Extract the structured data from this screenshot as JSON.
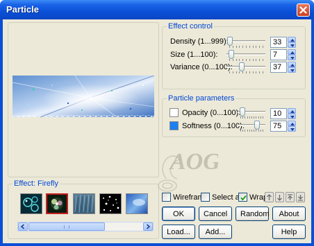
{
  "window": {
    "title": "Particle"
  },
  "preview": {
    "effect_label": "Effect: Firefly"
  },
  "effect_control": {
    "group_title": "Effect control",
    "rows": [
      {
        "label": "Density (1...999):",
        "value": "33",
        "level": 0.03
      },
      {
        "label": "Size (1...100):",
        "value": "7",
        "level": 0.06
      },
      {
        "label": "Variance (0...100):",
        "value": "37",
        "level": 0.37
      }
    ]
  },
  "particle_parameters": {
    "group_title": "Particle parameters",
    "rows": [
      {
        "label": "Opacity (0...100):",
        "value": "10",
        "level": 0.1,
        "swatch_color": "#ffffff"
      },
      {
        "label": "Softness (0...100):",
        "value": "75",
        "level": 0.75,
        "swatch_color": "#1a7ff0"
      }
    ]
  },
  "options": {
    "wireframe_label": "Wireframe",
    "wireframe_checked": false,
    "select_all_label": "Select all",
    "select_all_checked": false,
    "wrap_label": "Wrap",
    "wrap_checked": true
  },
  "buttons": {
    "ok": "OK",
    "cancel": "Cancel",
    "random": "Random",
    "about": "About",
    "load": "Load...",
    "add": "Add...",
    "help": "Help"
  },
  "watermark_text": "AOG",
  "colors": {
    "title_bar": "#0a50d8",
    "accent_text": "#0046d5",
    "dialog_bg": "#ece9d8",
    "close_button": "#c9401f"
  }
}
